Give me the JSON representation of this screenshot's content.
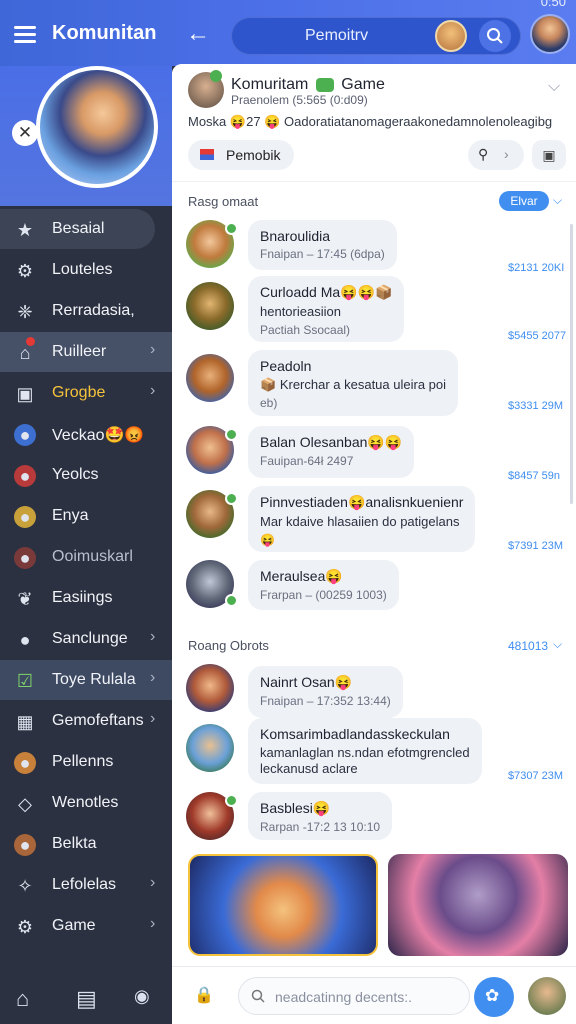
{
  "status": {
    "time": "0:50"
  },
  "topbar": {
    "title": "Komunitan",
    "pill_label": "Pemoitrv"
  },
  "sidebar": {
    "items": [
      {
        "label": "Besaial",
        "icon": "star-icon"
      },
      {
        "label": "Louteles",
        "icon": "gear-icon"
      },
      {
        "label": "Rerradasia,",
        "icon": "network-icon"
      },
      {
        "label": "Ruilleer",
        "icon": "home-icon"
      },
      {
        "label": "Grogbe",
        "icon": "box-icon"
      },
      {
        "label": "Veckao🤩😡",
        "icon": "avatar-icon"
      },
      {
        "label": "Yeolcs",
        "icon": "avatar-icon"
      },
      {
        "label": "Enya",
        "icon": "avatar-icon"
      },
      {
        "label": "Ooimuskarl",
        "icon": "avatar-icon"
      },
      {
        "label": "Easiings",
        "icon": "leaf-icon"
      },
      {
        "label": "Sanclunge",
        "icon": "pin-icon"
      },
      {
        "label": "Toye Rulala",
        "icon": "check-board-icon"
      },
      {
        "label": "Gemofeftans",
        "icon": "grid-icon"
      },
      {
        "label": "Pellenns",
        "icon": "ball-icon"
      },
      {
        "label": "Wenotles",
        "icon": "diamond-icon"
      },
      {
        "label": "Belkta",
        "icon": "ball-icon"
      },
      {
        "label": "Lefolelas",
        "icon": "sparkle-icon"
      },
      {
        "label": "Game",
        "icon": "gear-icon"
      }
    ]
  },
  "header": {
    "title_prefix": "Komuritam",
    "title_game": "Game",
    "subtitle": "Praenolem (5:565 (0:d09)",
    "desc_start": "Moska",
    "desc_num": "27",
    "desc_rest": "Oadoratiatanomageraakonedamnolenoleagibg",
    "chip_label": "Pemobik"
  },
  "sections": [
    {
      "label": "Rasg omaat",
      "action": "Elvar"
    },
    {
      "label": "Roang Obrots",
      "count": "481013"
    }
  ],
  "messages": [
    {
      "name": "Bnaroulidia",
      "meta": "Fnaipan – 17:45 (6dpa)",
      "amount": "$2131 20KI"
    },
    {
      "name": "Curloadd Ma😝😝📦",
      "line1": "hentorieasiion",
      "line2": "Pactiah Ssocaal)",
      "amount": "$5455 2077"
    },
    {
      "name": "Peadoln",
      "line1": "Krerchar a kesatua uleira poi",
      "line2": "eb)",
      "amount": "$3331 29M"
    },
    {
      "name": "Balan Olesanban😝😝",
      "meta": "Fauipan-64ł 2497",
      "amount": "$8457 59n"
    },
    {
      "name": "Pinnvestiaden😝analisnkuenienr",
      "line1": "Mar kdaive hlasaiien do patigelans",
      "line2": "😝",
      "amount": "$7391 23M"
    },
    {
      "name": "Meraulsea😝",
      "meta": "Frarpan – (00259 1003)"
    },
    {
      "name": "Nainrt Osan😝",
      "meta": "Fnaipan – 17:352 13:44)"
    },
    {
      "name": "Komsarimbadlandasskeckulan",
      "line1": "kamanlaglan ns.ndan efotmgrencled",
      "line2": "leckanusd aclare",
      "amount": "$7307 23M"
    },
    {
      "name": "Basblesi😝",
      "meta": "Rarpan -17:2 13 10:10"
    }
  ],
  "input": {
    "placeholder": "neadcatinng decents:."
  },
  "colors": {
    "accent": "#3f8ef0",
    "brand": "#4a6ee6",
    "sidebar": "#2b3140",
    "highlight": "#f5c23b"
  }
}
